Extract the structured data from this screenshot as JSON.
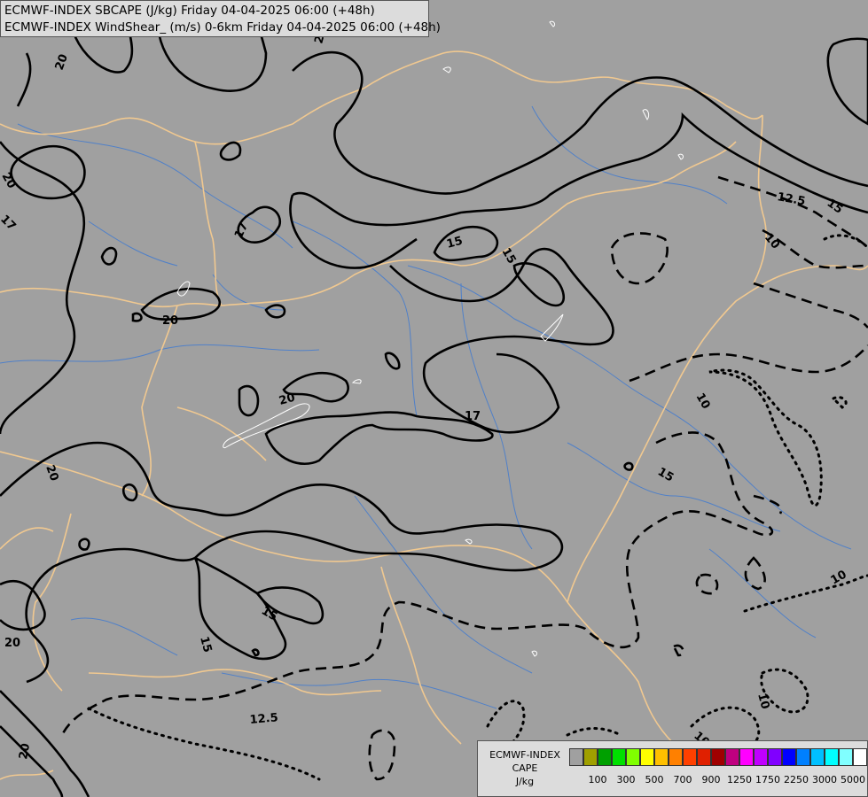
{
  "title": {
    "line1": "ECMWF-INDEX SBCAPE (J/kg) Friday 04-04-2025 06:00 (+48h)",
    "line2": "ECMWF-INDEX WindShear_ (m/s) 0-6km Friday 04-04-2025 06:00 (+48h)"
  },
  "map": {
    "background_color": "#a0a0a0",
    "border_color": "#f0c890",
    "river_color": "#5080c8",
    "contour_color": "#000000",
    "contour_labels": [
      "20",
      "20",
      "17",
      "17",
      "20",
      "20",
      "15",
      "15",
      "20",
      "17",
      "20",
      "20",
      "15",
      "15",
      "20",
      "12.5",
      "15",
      "10",
      "10",
      "15",
      "10",
      "10",
      "12.5",
      "10",
      "10",
      "20"
    ]
  },
  "legend": {
    "title": "ECMWF-INDEX",
    "variable": "CAPE",
    "unit": "J/kg",
    "colors": [
      "#a0a0a0",
      "#a0a000",
      "#00a000",
      "#00e000",
      "#80ff00",
      "#ffff00",
      "#ffc000",
      "#ff8000",
      "#ff4000",
      "#e02000",
      "#a00000",
      "#c00080",
      "#ff00ff",
      "#c000ff",
      "#8000ff",
      "#0000ff",
      "#0080ff",
      "#00c0ff",
      "#00ffff",
      "#80ffff",
      "#ffffff"
    ],
    "tick_labels": [
      "100",
      "300",
      "500",
      "700",
      "900",
      "1250",
      "1750",
      "2250",
      "3000",
      "5000"
    ]
  }
}
